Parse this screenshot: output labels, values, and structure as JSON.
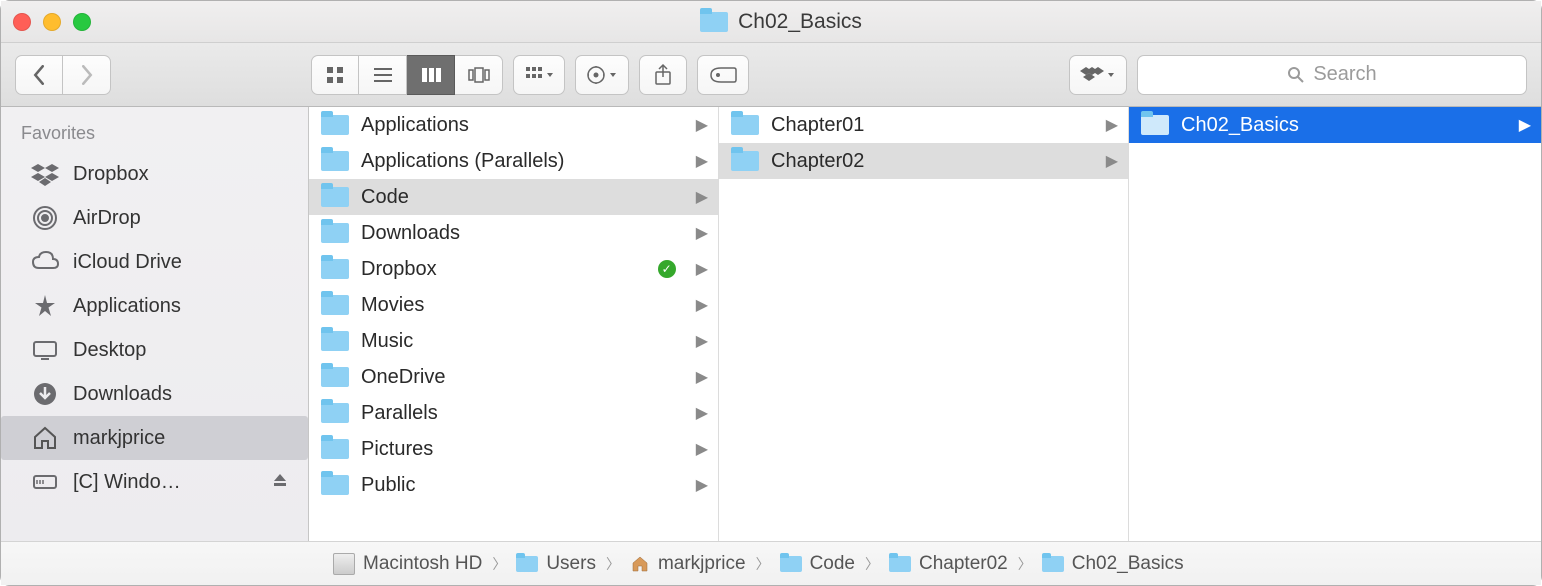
{
  "title": {
    "text": "Ch02_Basics"
  },
  "toolbar": {
    "search_placeholder": "Search"
  },
  "sidebar": {
    "heading": "Favorites",
    "items": [
      {
        "label": "Dropbox"
      },
      {
        "label": "AirDrop"
      },
      {
        "label": "iCloud Drive"
      },
      {
        "label": "Applications"
      },
      {
        "label": "Desktop"
      },
      {
        "label": "Downloads"
      },
      {
        "label": "markjprice"
      },
      {
        "label": "[C] Windo…"
      }
    ]
  },
  "column0": [
    {
      "label": "Applications"
    },
    {
      "label": "Applications (Parallels)"
    },
    {
      "label": "Code"
    },
    {
      "label": "Downloads"
    },
    {
      "label": "Dropbox"
    },
    {
      "label": "Movies"
    },
    {
      "label": "Music"
    },
    {
      "label": "OneDrive"
    },
    {
      "label": "Parallels"
    },
    {
      "label": "Pictures"
    },
    {
      "label": "Public"
    }
  ],
  "column1": [
    {
      "label": "Chapter01"
    },
    {
      "label": "Chapter02"
    }
  ],
  "column2": [
    {
      "label": "Ch02_Basics"
    }
  ],
  "path": [
    {
      "label": "Macintosh HD"
    },
    {
      "label": "Users"
    },
    {
      "label": "markjprice"
    },
    {
      "label": "Code"
    },
    {
      "label": "Chapter02"
    },
    {
      "label": "Ch02_Basics"
    }
  ]
}
